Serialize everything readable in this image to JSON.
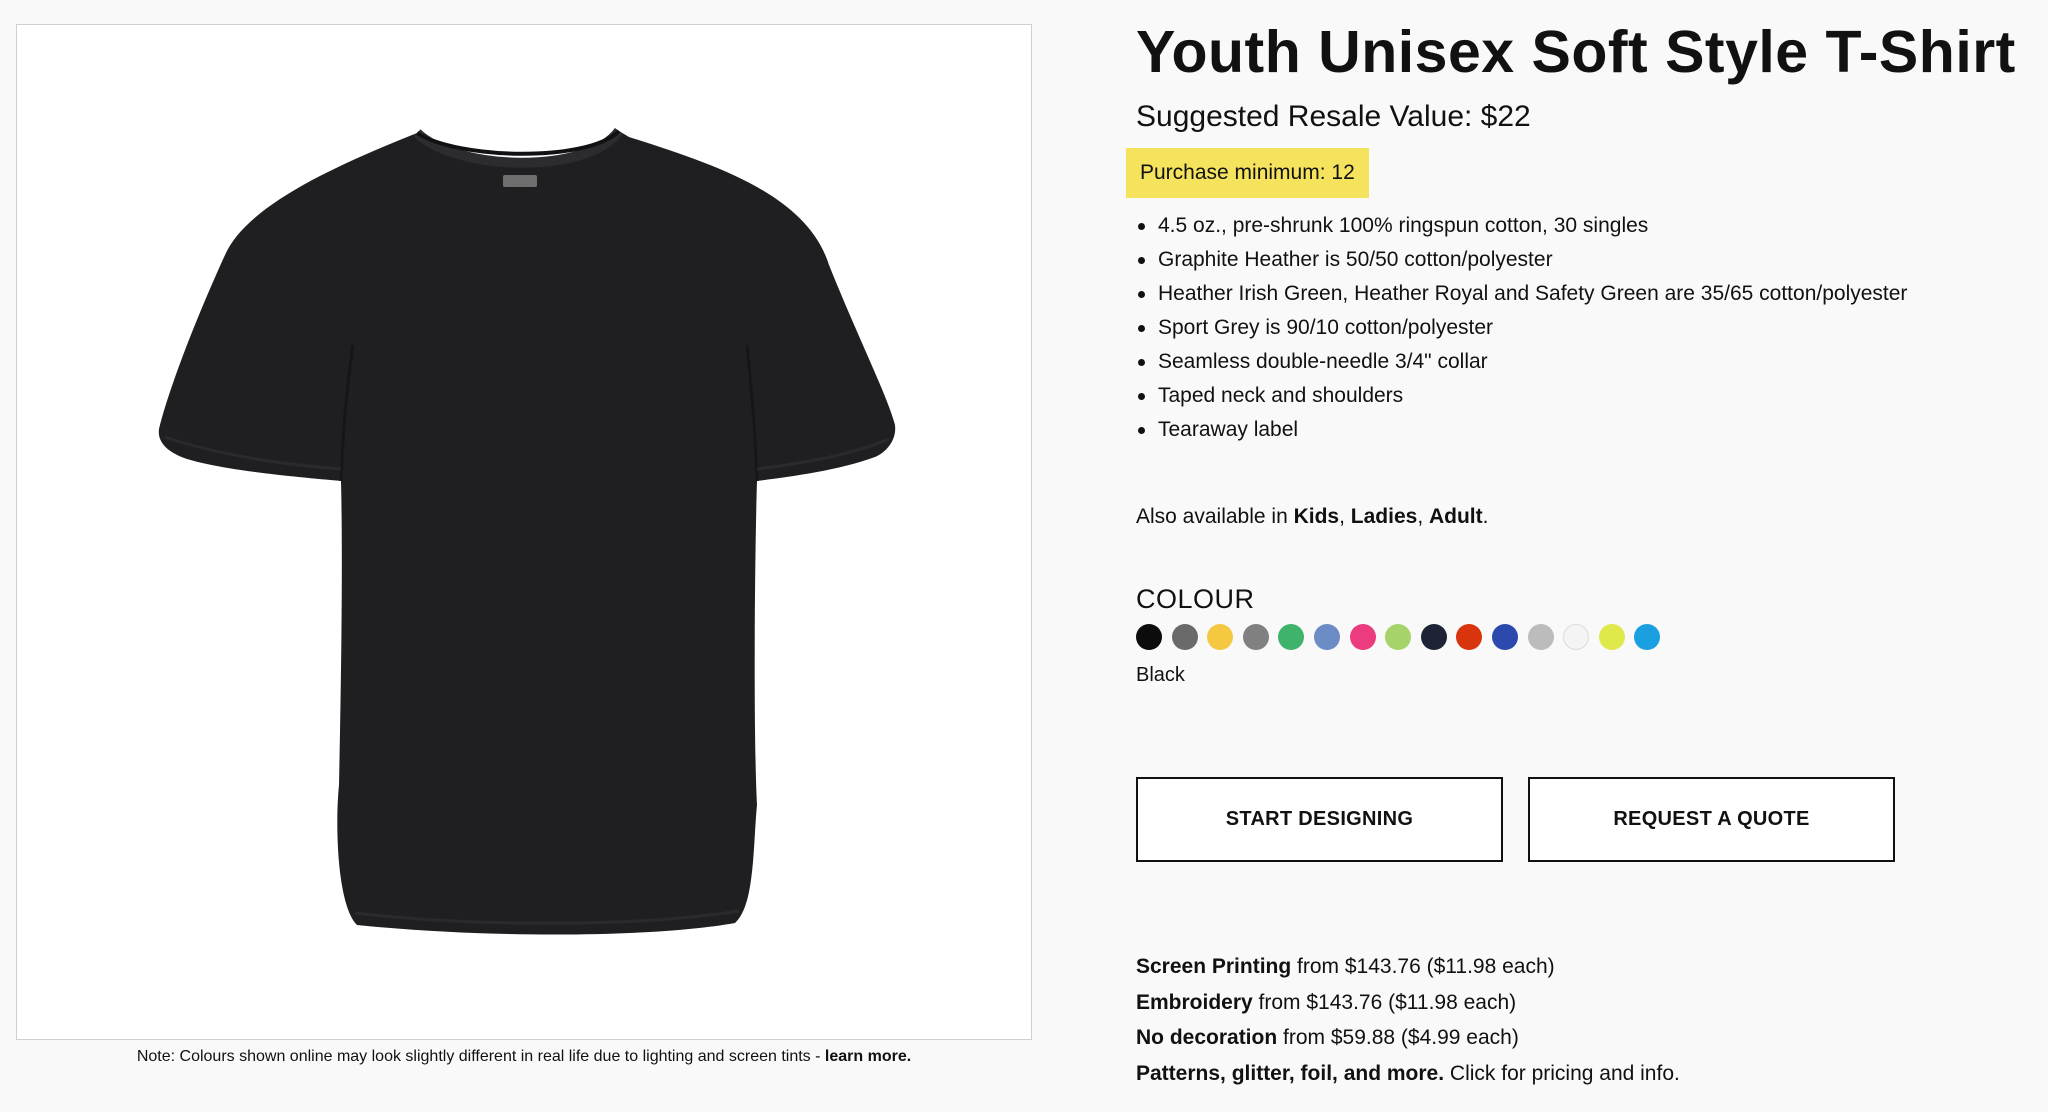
{
  "product": {
    "title": "Youth Unisex Soft Style T-Shirt",
    "suggested_resale": "Suggested Resale Value: $22",
    "purchase_minimum": "Purchase minimum: 12",
    "features": [
      "4.5 oz., pre-shrunk 100% ringspun cotton, 30 singles",
      "Graphite Heather is 50/50 cotton/polyester",
      "Heather Irish Green, Heather Royal and Safety Green are 35/65 cotton/polyester",
      "Sport Grey is 90/10 cotton/polyester",
      "Seamless double-needle 3/4\" collar",
      "Taped neck and shoulders",
      "Tearaway label"
    ]
  },
  "also_available": {
    "prefix": "Also available in ",
    "links": [
      "Kids",
      "Ladies",
      "Adult"
    ],
    "sep": ", ",
    "end": "."
  },
  "colour": {
    "heading": "COLOUR",
    "selected_name": "Black",
    "swatches": [
      "#0c0c0c",
      "#6a6a6a",
      "#f5c842",
      "#808080",
      "#3fb36c",
      "#6b8cc4",
      "#ec3c7f",
      "#a6d46b",
      "#1e2436",
      "#d8350f",
      "#2c4aad",
      "#bcbcbc",
      "#f4f4f4",
      "#dfe94a",
      "#1aa0e0"
    ]
  },
  "buttons": {
    "start": "START DESIGNING",
    "quote": "REQUEST A QUOTE"
  },
  "pricing": [
    {
      "label": "Screen Printing",
      "text": " from $143.76 ($11.98 each)"
    },
    {
      "label": "Embroidery",
      "text": " from $143.76 ($11.98 each)"
    },
    {
      "label": "No decoration",
      "text": " from $59.88 ($4.99 each)"
    },
    {
      "label": "Patterns, glitter, foil, and more.",
      "text": " Click for pricing and info."
    }
  ],
  "note": {
    "text": "Note: Colours shown online may look slightly different in real life due to lighting and screen tints - ",
    "link": "learn more."
  }
}
